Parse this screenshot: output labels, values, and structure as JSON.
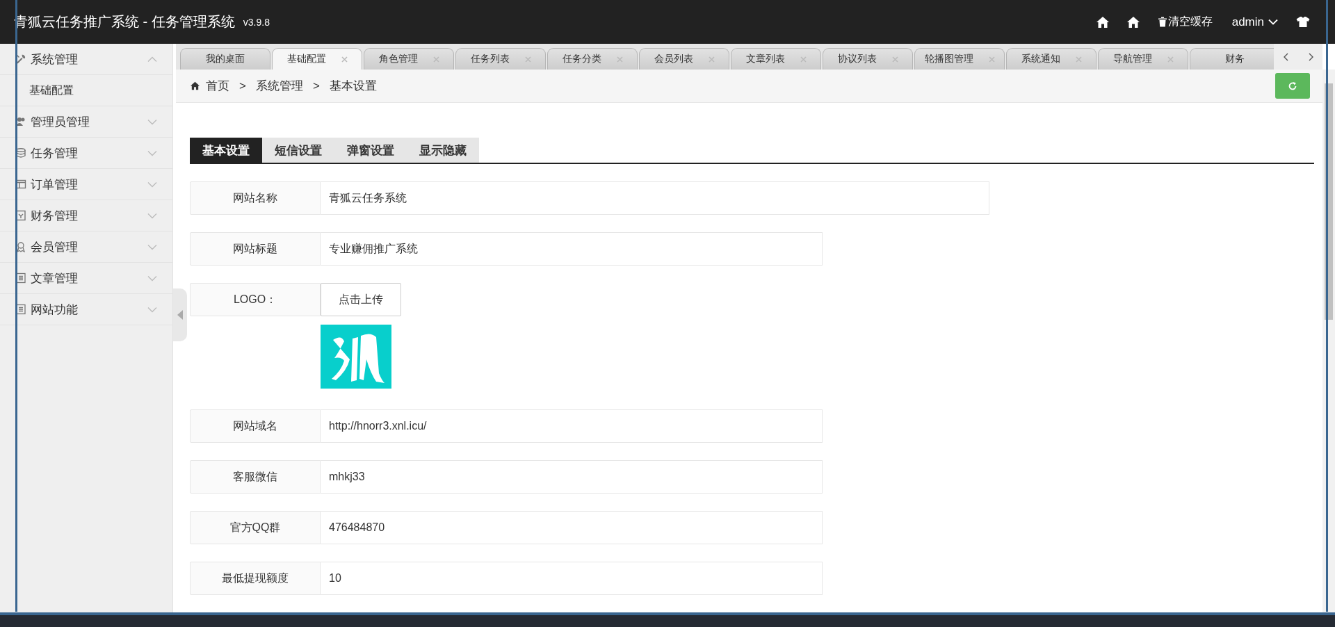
{
  "header": {
    "title": "青狐云任务推广系统 - 任务管理系统",
    "version": "v3.9.8",
    "clear_cache": "清空缓存",
    "user": "admin"
  },
  "sidebar": {
    "items": [
      {
        "label": "系统管理",
        "kind": "tools",
        "expanded": true,
        "children": [
          {
            "label": "基础配置"
          }
        ]
      },
      {
        "label": "管理员管理",
        "kind": "users",
        "expanded": false
      },
      {
        "label": "任务管理",
        "kind": "database",
        "expanded": false
      },
      {
        "label": "订单管理",
        "kind": "window",
        "expanded": false
      },
      {
        "label": "财务管理",
        "kind": "ledger",
        "expanded": false
      },
      {
        "label": "会员管理",
        "kind": "award",
        "expanded": false
      },
      {
        "label": "文章管理",
        "kind": "list",
        "expanded": false
      },
      {
        "label": "网站功能",
        "kind": "list",
        "expanded": false
      }
    ]
  },
  "page_tabs": [
    {
      "label": "我的桌面",
      "selected": false,
      "closable": false
    },
    {
      "label": "基础配置",
      "selected": true,
      "closable": true
    },
    {
      "label": "角色管理",
      "selected": false,
      "closable": true
    },
    {
      "label": "任务列表",
      "selected": false,
      "closable": true
    },
    {
      "label": "任务分类",
      "selected": false,
      "closable": true
    },
    {
      "label": "会员列表",
      "selected": false,
      "closable": true
    },
    {
      "label": "文章列表",
      "selected": false,
      "closable": true
    },
    {
      "label": "协议列表",
      "selected": false,
      "closable": true
    },
    {
      "label": "轮播图管理",
      "selected": false,
      "closable": true
    },
    {
      "label": "系统通知",
      "selected": false,
      "closable": true
    },
    {
      "label": "导航管理",
      "selected": false,
      "closable": true
    },
    {
      "label": "财务",
      "selected": false,
      "closable": false
    }
  ],
  "breadcrumb": {
    "items": [
      "首页",
      "系统管理",
      "基本设置"
    ],
    "separator": ">"
  },
  "settings_tabs": [
    {
      "label": "基本设置",
      "selected": true
    },
    {
      "label": "短信设置",
      "selected": false
    },
    {
      "label": "弹窗设置",
      "selected": false
    },
    {
      "label": "显示隐藏",
      "selected": false
    }
  ],
  "fields": [
    {
      "kind": "text",
      "label": "网站名称",
      "value": "青狐云任务系统",
      "wide": true
    },
    {
      "kind": "text",
      "label": "网站标题",
      "value": "专业赚佣推广系统",
      "wide": false
    },
    {
      "kind": "upload",
      "label": "LOGO：",
      "button": "点击上传"
    },
    {
      "kind": "text",
      "label": "网站域名",
      "value": "http://hnorr3.xnl.icu/",
      "wide": false
    },
    {
      "kind": "text",
      "label": "客服微信",
      "value": "mhkj33",
      "wide": false
    },
    {
      "kind": "text",
      "label": "官方QQ群",
      "value": "476484870",
      "wide": false
    },
    {
      "kind": "text",
      "label": "最低提现额度",
      "value": "10",
      "wide": false
    }
  ]
}
